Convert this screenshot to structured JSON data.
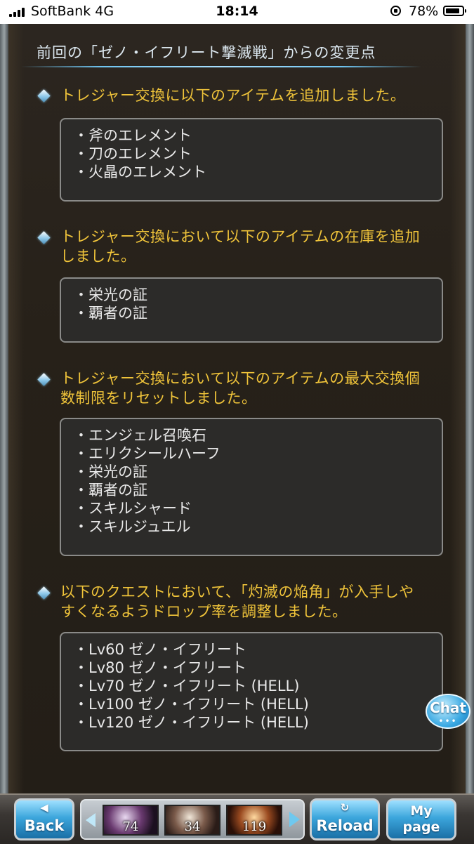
{
  "status_bar": {
    "carrier": "SoftBank 4G",
    "time": "18:14",
    "battery": "78%"
  },
  "header": {
    "title": "前回の「ゼノ・イフリート撃滅戦」からの変更点"
  },
  "sections": [
    {
      "lines": [
        "トレジャー交換に以下のアイテムを追加しました。"
      ],
      "items": [
        "・斧のエレメント",
        "・刀のエレメント",
        "・火晶のエレメント"
      ]
    },
    {
      "lines": [
        "トレジャー交換において以下のアイテムの在庫を追加",
        "しました。"
      ],
      "items": [
        "・栄光の証",
        "・覇者の証"
      ]
    },
    {
      "lines": [
        "トレジャー交換において以下のアイテムの最大交換個",
        "数制限をリセットしました。"
      ],
      "items": [
        "・エンジェル召喚石",
        "・エリクシールハーフ",
        "・栄光の証",
        "・覇者の証",
        "・スキルシャード",
        "・スキルジュエル"
      ]
    },
    {
      "lines": [
        "以下のクエストにおいて、「灼滅の焔角」が入手しや",
        "すくなるようドロップ率を調整しました。"
      ],
      "items": [
        "・Lv60 ゼノ・イフリート",
        "・Lv80 ゼノ・イフリート",
        "・Lv70 ゼノ・イフリート (HELL)",
        "・Lv100 ゼノ・イフリート (HELL)",
        "・Lv120 ゼノ・イフリート (HELL)"
      ]
    }
  ],
  "chat": {
    "label": "Chat",
    "dots": "•••"
  },
  "bottom_bar": {
    "back_label": "Back",
    "reload_label": "Reload",
    "mypage_label_1": "My",
    "mypage_label_2": "page",
    "quick_items": [
      {
        "count": "74"
      },
      {
        "count": "34"
      },
      {
        "count": "119"
      }
    ]
  },
  "icons": {
    "section_marker": "diamond-icon",
    "back": "back-arrow-icon",
    "reload": "reload-icon"
  },
  "colors": {
    "heading_text": "#f0c43a",
    "item_text": "#e9e9e9",
    "accent_blue": "#3ca6dc"
  }
}
